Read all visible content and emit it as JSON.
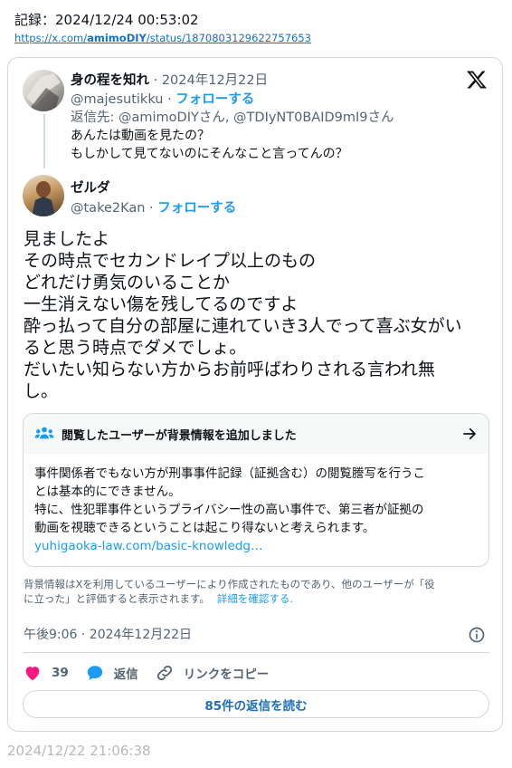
{
  "record": {
    "label": "記録：2024/12/24 00:53:02",
    "url_prefix": "https://x.com/",
    "url_handle": "amimoDIY",
    "url_suffix": "/status/1870803129622757653"
  },
  "reply_tweet": {
    "name": "身の程を知れ",
    "dot_date": "· 2024年12月22日",
    "handle": "@majesutikku",
    "follow_sep": "·",
    "follow_label": "フォローする",
    "reply_to": "返信先: @amimoDIYさん, @TDIyNT0BAID9mI9さん",
    "text_lines": [
      "あんたは動画を見たの？",
      "もしかして見てないのにそんなこと言ってんの？"
    ]
  },
  "main_tweet": {
    "name": "ゼルダ",
    "handle": "@take2Kan",
    "follow_sep": "·",
    "follow_label": "フォローする",
    "text_lines": [
      "見ましたよ",
      "その時点でセカンドレイプ以上のもの",
      "どれだけ勇気のいることか",
      "一生消えない傷を残してるのですよ",
      "酔っ払って自分の部屋に連れていき3人でって喜ぶ女がい",
      "ると思う時点でダメでしょ。",
      "だいたい知らない方からお前呼ばわりされる言われ無",
      "し。"
    ]
  },
  "community_note": {
    "header": "閲覧したユーザーが背景情報を追加しました",
    "body_lines": [
      "事件関係者でもない方が刑事事件記録（証拠含む）の閲覧謄写を行うこ",
      "とは基本的にできません。",
      "特に、性犯罪事件というプライバシー性の高い事件で、第三者が証拠の",
      "動画を視聴できるということは起こり得ないと考えられます。"
    ],
    "link": "yuhigaoka-law.com/basic-knowledg…",
    "disclaimer_lines": [
      "背景情報はXを利用しているユーザーにより作成されたものであり、他のユーザーが「役",
      "に立った」と評価すると表示されます。"
    ],
    "more_label": "詳細を確認する."
  },
  "meta": {
    "timestamp": "午後9:06 · 2024年12月22日"
  },
  "actions": {
    "like_count": "39",
    "reply_label": "返信",
    "copy_link_label": "リンクをコピー",
    "read_replies_label": "85件の返信を読む"
  },
  "footer": {
    "date": "2024/12/22 21:06:38"
  },
  "colors": {
    "accent": "#1d9bf0",
    "like": "#f91880",
    "muted": "#536471",
    "border": "#cfd9de"
  }
}
